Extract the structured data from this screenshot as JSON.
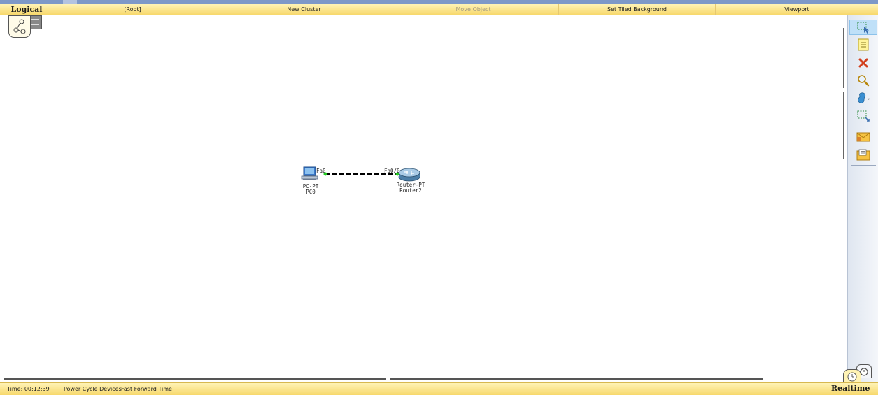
{
  "toolbar": {
    "logical_label": "Logical",
    "root_label": "[Root]",
    "new_cluster_label": "New Cluster",
    "move_object_label": "Move Object",
    "set_tiled_background_label": "Set Tiled Background",
    "viewport_label": "Viewport"
  },
  "devices": {
    "pc": {
      "type_label": "PC-PT",
      "name_label": "PC0",
      "port_label": "Fa0"
    },
    "router": {
      "type_label": "Router-PT",
      "name_label": "Router2",
      "port_label": "Fa0/0"
    }
  },
  "link": {
    "style": "dashed",
    "color": "#000000",
    "endpoint_color": "#22cc22"
  },
  "sidebar": {
    "tools": [
      "select-icon",
      "note-icon",
      "delete-icon",
      "inspect-icon",
      "draw-shape-icon",
      "resize-icon",
      "add-simple-pdu-icon",
      "add-complex-pdu-icon"
    ]
  },
  "bottom": {
    "time_text": "Time: 00:12:39",
    "power_cycle_label": "Power Cycle Devices",
    "fast_forward_label": "Fast Forward Time",
    "mode_label": "Realtime"
  },
  "colors": {
    "toolbar": "#f7d86c",
    "sidebar_active": "#bfe0f8",
    "link_up": "#22cc22"
  }
}
